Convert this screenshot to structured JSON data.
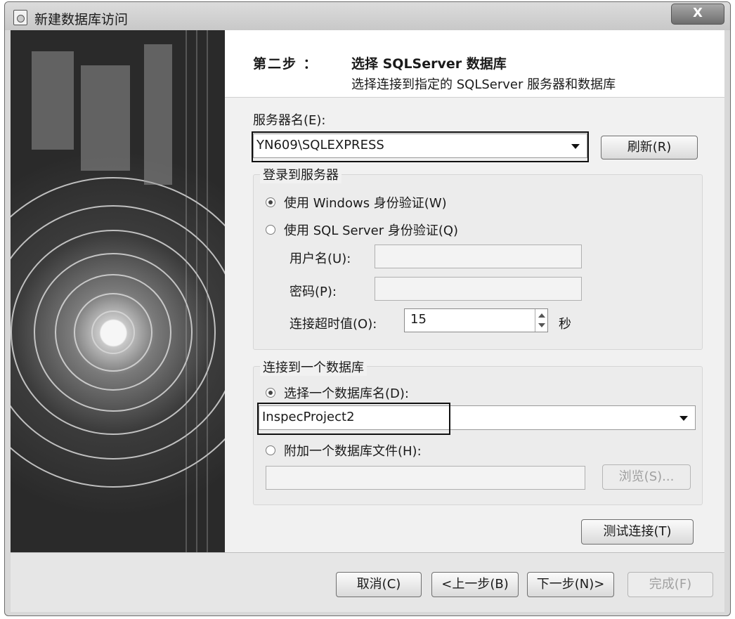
{
  "window": {
    "title": "新建数据库访问",
    "close_label": "X"
  },
  "header": {
    "step_number": "第二步 ：",
    "step_title": "选择 SQLServer 数据库",
    "step_desc": "选择连接到指定的 SQLServer 服务器和数据库"
  },
  "server": {
    "label": "服务器名(E):",
    "value": "YN609\\SQLEXPRESS",
    "refresh_label": "刷新(R)"
  },
  "login": {
    "group_title": "登录到服务器",
    "windows_auth": "使用 Windows 身份验证(W)",
    "sql_auth": "使用 SQL Server 身份验证(Q)",
    "username_label": "用户名(U):",
    "password_label": "密码(P):",
    "timeout_label": "连接超时值(O):",
    "timeout_value": "15",
    "timeout_unit": "秒",
    "selected": "windows"
  },
  "database": {
    "group_title": "连接到一个数据库",
    "select_db_label": "选择一个数据库名(D):",
    "db_value": "InspecProject2",
    "attach_label": "附加一个数据库文件(H):",
    "browse_label": "浏览(S)...",
    "selected": "select"
  },
  "test_connection_label": "测试连接(T)",
  "footer": {
    "cancel": "取消(C)",
    "back": "<上一步(B)",
    "next": "下一步(N)>",
    "finish": "完成(F)"
  }
}
